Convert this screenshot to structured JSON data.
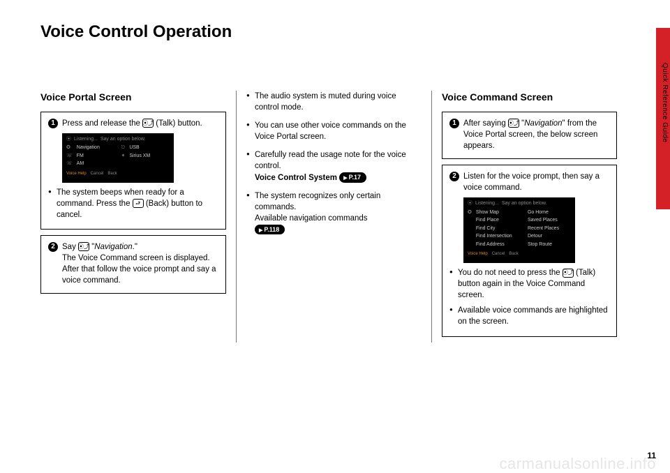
{
  "page": {
    "title": "Voice Control Operation",
    "section_tab": "Quick Reference Guide",
    "number": "11",
    "watermark": "carmanualsonline.info"
  },
  "col1": {
    "heading": "Voice Portal Screen",
    "step1_num": "1",
    "step1_pre": "Press and release the ",
    "step1_post": " (Talk) button.",
    "screen1": {
      "listening": "Listening...",
      "hint": "Say an option below.",
      "opt1": "Navigation",
      "opt2": "USB",
      "opt3": "FM",
      "opt4": "Sirius XM",
      "opt5": "AM",
      "foot1": "Voice Help",
      "foot2": "Cancel",
      "foot3": "Back"
    },
    "step1_bullet_pre": "The system beeps when ready for a command. Press the ",
    "step1_bullet_post": " (Back) button to cancel.",
    "step2_num": "2",
    "step2_pre": "Say ",
    "step2_quote_open": " \"",
    "step2_word": "Navigation",
    "step2_quote_close": ".\"",
    "step2_line2": "The Voice Command screen is displayed.",
    "step2_line3": "After that follow the voice prompt and say a voice command."
  },
  "col2": {
    "b1": "The audio system is muted during voice control mode.",
    "b2": "You can use other voice commands on the Voice Portal screen.",
    "b3": "Carefully read the usage note for the voice control.",
    "b3_link_label": "Voice Control System",
    "b3_link_page": "P.17",
    "b4": "The system recognizes only certain commands.",
    "b4_sub": "Available navigation commands",
    "b4_link_page": "P.118"
  },
  "col3": {
    "heading": "Voice Command Screen",
    "step1_num": "1",
    "step1_pre": "After saying ",
    "step1_quote_open": " \"",
    "step1_word": "Navigation",
    "step1_quote_close": "\" ",
    "step1_post": "from the Voice Portal screen, the below screen appears.",
    "step2_num": "2",
    "step2_text": "Listen for the voice prompt, then say a voice command.",
    "screen2": {
      "listening": "Listening...",
      "hint": "Say an option below.",
      "o1": "Show Map",
      "o2": "Go Home",
      "o3": "Find Place",
      "o4": "Saved Places",
      "o5": "Find City",
      "o6": "Recent Places",
      "o7": "Find Intersection",
      "o8": "Detour",
      "o9": "Find Address",
      "o10": "Stop Route",
      "foot1": "Voice Help",
      "foot2": "Cancel",
      "foot3": "Back"
    },
    "bullet1_pre": "You do not need to press the ",
    "bullet1_post": " (Talk) button again in the Voice Command screen.",
    "bullet2": "Available voice commands are highlighted on the screen."
  }
}
